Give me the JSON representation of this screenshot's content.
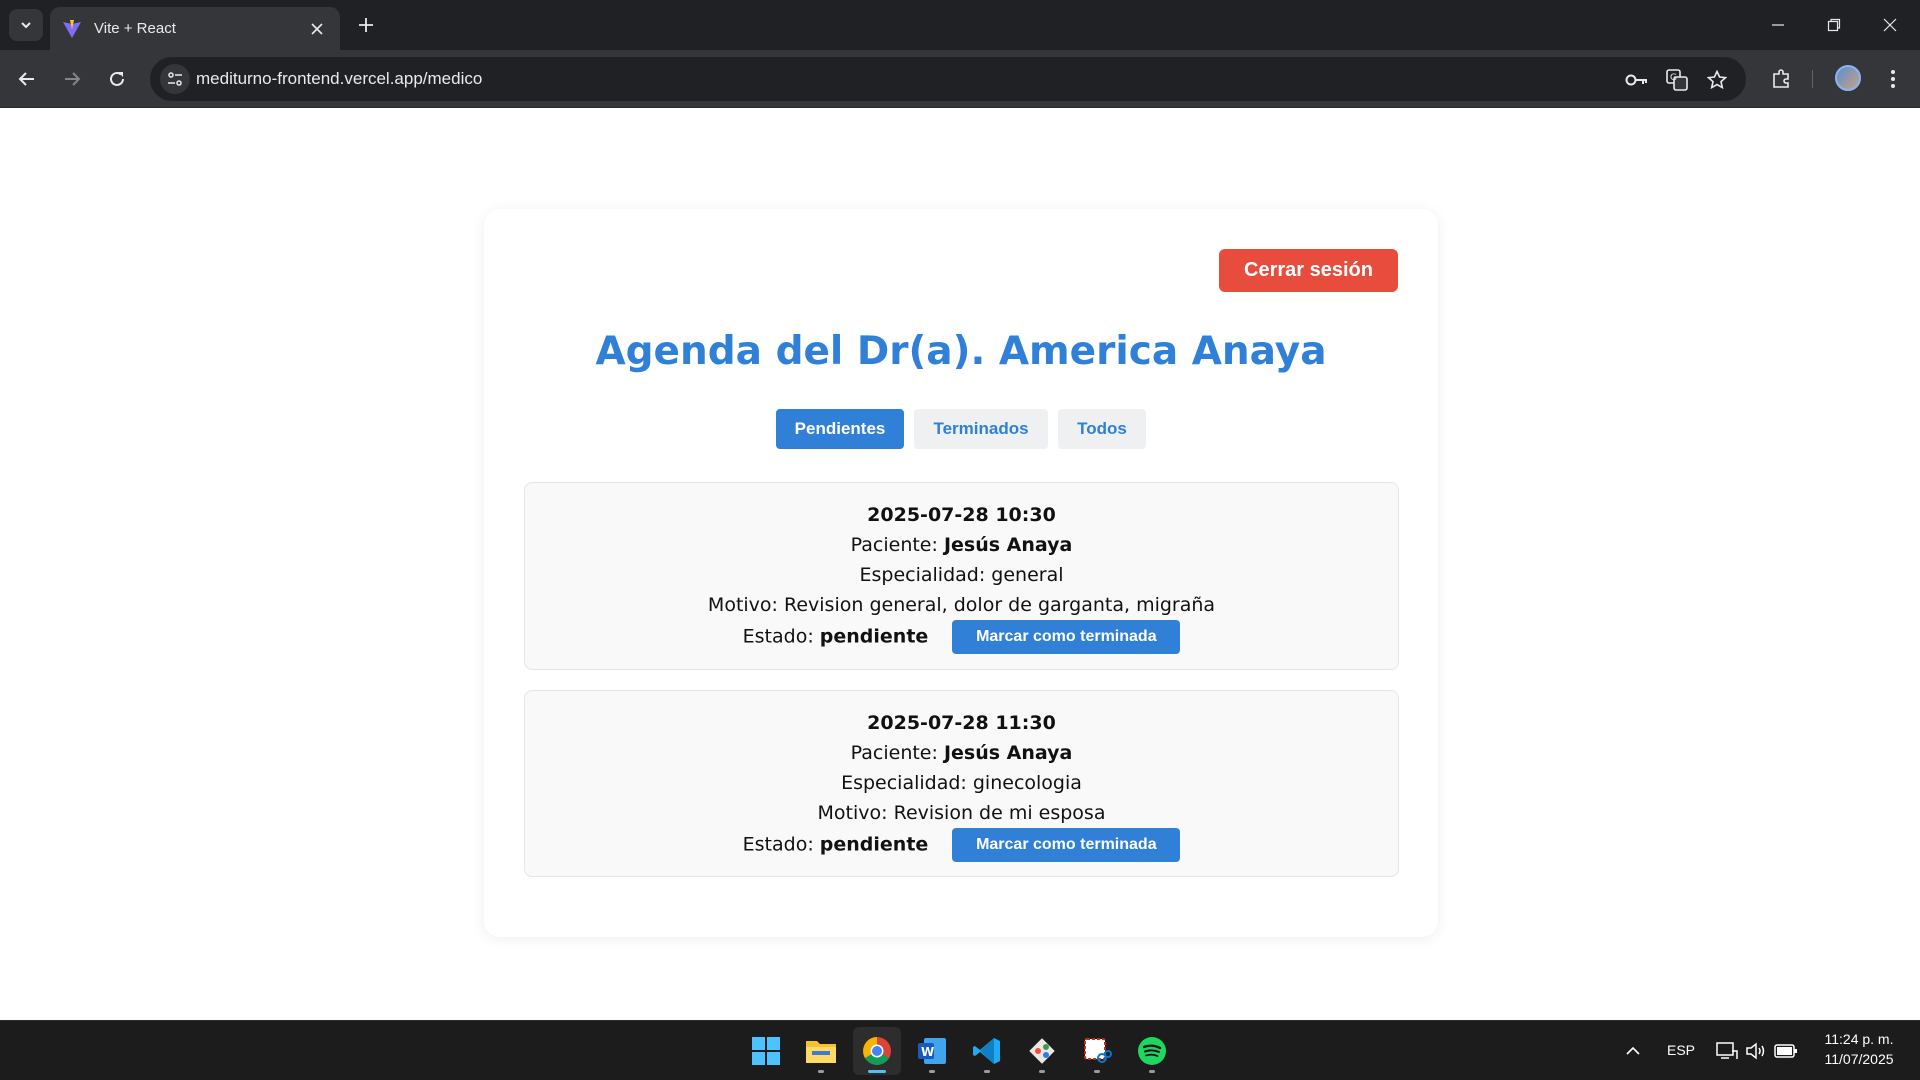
{
  "browser": {
    "tab_title": "Vite + React",
    "url": "mediturno-frontend.vercel.app/medico"
  },
  "page": {
    "logout_label": "Cerrar sesión",
    "title": "Agenda del Dr(a). America Anaya",
    "filters": [
      {
        "label": "Pendientes",
        "active": true
      },
      {
        "label": "Terminados",
        "active": false
      },
      {
        "label": "Todos",
        "active": false
      }
    ],
    "field_labels": {
      "patient": "Paciente:",
      "specialty": "Especialidad:",
      "reason": "Motivo:",
      "status": "Estado:"
    },
    "appointments": [
      {
        "datetime": "2025-07-28 10:30",
        "patient": "Jesús Anaya",
        "specialty": "general",
        "reason": "Revision general, dolor de garganta, migraña",
        "status": "pendiente",
        "action_label": "Marcar como terminada"
      },
      {
        "datetime": "2025-07-28 11:30",
        "patient": "Jesús Anaya",
        "specialty": "ginecologia",
        "reason": "Revision de mi esposa",
        "status": "pendiente",
        "action_label": "Marcar como terminada"
      }
    ]
  },
  "taskbar": {
    "apps": [
      "start-icon",
      "file-explorer-icon",
      "chrome-icon",
      "word-icon",
      "vscode-icon",
      "git-icon",
      "snipping-tool-icon",
      "spotify-icon"
    ],
    "language": "ESP",
    "time": "11:24 p. m.",
    "date": "11/07/2025"
  },
  "colors": {
    "accent": "#2f80d6",
    "logout": "#e74c3c",
    "card_bg": "#f9f9f9",
    "chrome_dark": "#202124",
    "chrome_toolbar": "#35363a"
  }
}
